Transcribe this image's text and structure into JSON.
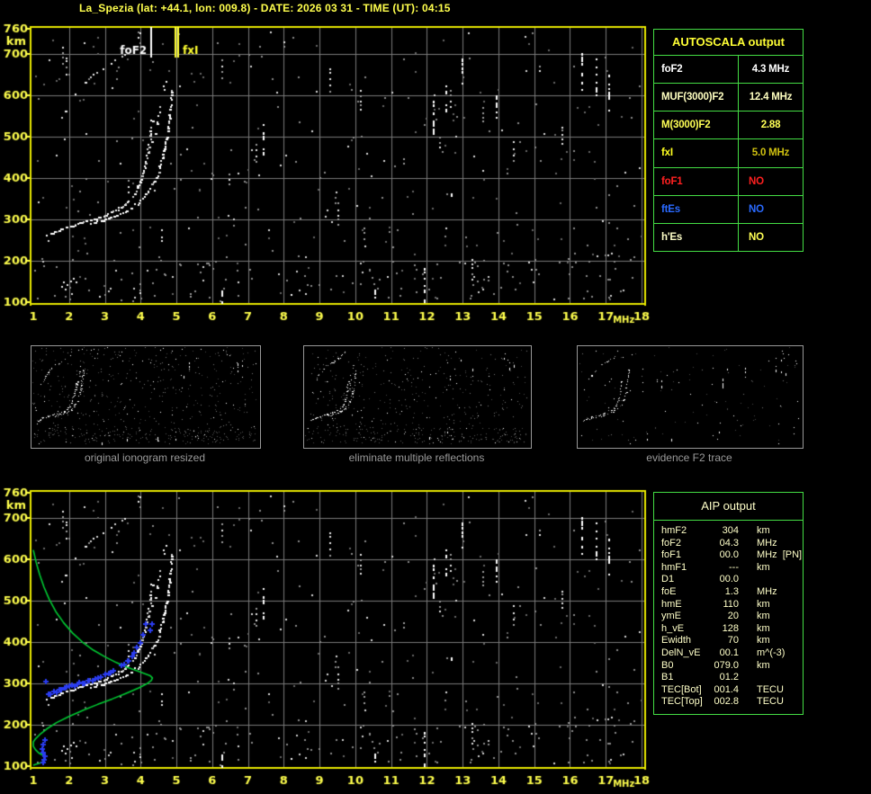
{
  "header": {
    "title": "La_Spezia (lat: +44.1, lon: 009.8) - DATE: 2026 03 31 - TIME (UT): 04:15"
  },
  "colors": {
    "background": "#000000",
    "title_yellow": "#ffff4d",
    "axis_yellow": "#ffff4d",
    "plot_border_yellow": "#e8e800",
    "grid_gray": "#7a7a7a",
    "trace_white": "#ffffff",
    "noise_gray": "#8a8a8a",
    "table_border_green": "#44dd44",
    "profile_green": "#00cc33",
    "scaled_blue": "#2a3cf0",
    "caption_gray": "#9a9a9a",
    "status_red": "#ff2020",
    "status_blue": "#2a6aff",
    "pale_yellow": "#ffffc8",
    "gold": "#cfc010",
    "marker_fof2": "#ffffff",
    "marker_fxi": "#ffff30"
  },
  "autoscala_table": {
    "title": "AUTOSCALA output",
    "rows": [
      {
        "label": "foF2",
        "value": "4.3 MHz",
        "color": "#ffffff",
        "value_color": "#ffffff"
      },
      {
        "label": "MUF(3000)F2",
        "value": "12.4 MHz",
        "color": "#ffffc0",
        "value_color": "#ffffc0"
      },
      {
        "label": "M(3000)F2",
        "value": "2.88",
        "color": "#ffff55",
        "value_color": "#ffff55"
      },
      {
        "label": "fxI",
        "value": "5.0 MHz",
        "color": "#ffff20",
        "value_color": "#cfc010"
      },
      {
        "label": "foF1",
        "value": "NO",
        "color": "#ff2020",
        "value_color": "#ff2020"
      },
      {
        "label": "ftEs",
        "value": "NO",
        "color": "#2a6aff",
        "value_color": "#2a6aff"
      },
      {
        "label": "h'Es",
        "value": "NO",
        "color": "#ffffc8",
        "value_color": "#ffff55"
      }
    ]
  },
  "aip_table": {
    "title": "AIP output",
    "rows": [
      {
        "label": "hmF2",
        "value": "304",
        "unit": "km"
      },
      {
        "label": "foF2",
        "value": "04.3",
        "unit": "MHz"
      },
      {
        "label": "foF1",
        "value": "00.0",
        "unit": "MHz  [PN]"
      },
      {
        "label": "hmF1",
        "value": "---",
        "unit": "km"
      },
      {
        "label": "D1",
        "value": "00.0",
        "unit": ""
      },
      {
        "label": "foE",
        "value": "1.3",
        "unit": "MHz"
      },
      {
        "label": "hmE",
        "value": "110",
        "unit": "km"
      },
      {
        "label": "ymE",
        "value": "20",
        "unit": "km"
      },
      {
        "label": "h_vE",
        "value": "128",
        "unit": "km"
      },
      {
        "label": "Ewidth",
        "value": "70",
        "unit": "km"
      },
      {
        "label": "DelN_vE",
        "value": "00.1",
        "unit": "m^(-3)"
      },
      {
        "label": "B0",
        "value": "079.0",
        "unit": "km"
      },
      {
        "label": "B1",
        "value": "01.2",
        "unit": ""
      },
      {
        "label": "TEC[Bot]",
        "value": "001.4",
        "unit": "TECU"
      },
      {
        "label": "TEC[Top]",
        "value": "002.8",
        "unit": "TECU"
      }
    ]
  },
  "thumbnails": [
    {
      "caption": "original ionogram resized"
    },
    {
      "caption": "eliminate multiple reflections"
    },
    {
      "caption": "evidence F2 trace"
    }
  ],
  "chart_data": {
    "type": "scatter",
    "title": "vertical-incidence ionogram, virtual height vs frequency",
    "xlabel": "MHz",
    "ylabel": "km",
    "xlim": [
      1,
      18
    ],
    "ylim": [
      100,
      760
    ],
    "x_ticks": [
      1,
      2,
      3,
      4,
      5,
      6,
      7,
      8,
      9,
      10,
      11,
      12,
      13,
      14,
      15,
      16,
      17,
      18
    ],
    "y_ticks": [
      760,
      700,
      600,
      500,
      400,
      300,
      200,
      100
    ],
    "grid": true,
    "markers": {
      "foF2_label": "foF2",
      "foF2_MHz": 4.3,
      "fxI_label": "fxI",
      "fxI_MHz": 5.0
    },
    "noise_seed": 7,
    "o_trace": [
      [
        1.38,
        262
      ],
      [
        1.6,
        271
      ],
      [
        1.85,
        279
      ],
      [
        2.1,
        286
      ],
      [
        2.4,
        293
      ],
      [
        2.7,
        301
      ],
      [
        3.0,
        310
      ],
      [
        3.25,
        320
      ],
      [
        3.5,
        333
      ],
      [
        3.7,
        348
      ],
      [
        3.85,
        366
      ],
      [
        3.98,
        389
      ],
      [
        4.08,
        414
      ],
      [
        4.16,
        444
      ],
      [
        4.23,
        480
      ],
      [
        4.28,
        515
      ],
      [
        4.32,
        545
      ]
    ],
    "x_trace": [
      [
        2.6,
        290
      ],
      [
        2.95,
        299
      ],
      [
        3.25,
        308
      ],
      [
        3.55,
        318
      ],
      [
        3.8,
        331
      ],
      [
        4.0,
        346
      ],
      [
        4.2,
        365
      ],
      [
        4.37,
        389
      ],
      [
        4.5,
        416
      ],
      [
        4.6,
        447
      ],
      [
        4.69,
        482
      ],
      [
        4.76,
        520
      ],
      [
        4.82,
        560
      ],
      [
        4.86,
        600
      ],
      [
        4.88,
        625
      ]
    ],
    "hop2_o": [
      [
        1.8,
        548
      ],
      [
        2.0,
        578
      ],
      [
        2.2,
        602
      ],
      [
        2.5,
        638
      ],
      [
        2.85,
        660
      ],
      [
        3.2,
        678
      ],
      [
        3.55,
        697
      ],
      [
        3.8,
        716
      ],
      [
        3.95,
        738
      ],
      [
        4.03,
        757
      ]
    ],
    "hop2_x": [
      [
        4.28,
        478
      ],
      [
        4.38,
        508
      ],
      [
        4.48,
        545
      ],
      [
        4.58,
        582
      ],
      [
        4.66,
        620
      ],
      [
        4.72,
        655
      ]
    ],
    "e_cluster": [
      [
        1.78,
        138
      ],
      [
        1.85,
        148
      ],
      [
        1.95,
        143
      ],
      [
        2.05,
        150
      ],
      [
        2.12,
        158
      ],
      [
        1.9,
        132
      ],
      [
        2.2,
        148
      ]
    ],
    "streaks": [
      [
        6.28,
        100,
        128
      ],
      [
        8.22,
        100,
        130
      ],
      [
        10.55,
        100,
        142
      ],
      [
        11.95,
        106,
        182
      ],
      [
        7.45,
        460,
        540
      ],
      [
        12.2,
        500,
        585
      ],
      [
        12.55,
        545,
        622
      ],
      [
        13.0,
        618,
        688
      ],
      [
        13.95,
        545,
        622
      ],
      [
        16.35,
        608,
        700
      ],
      [
        16.75,
        596,
        688
      ],
      [
        17.1,
        554,
        648
      ],
      [
        12.7,
        350,
        362
      ]
    ],
    "profile_green": [
      [
        1.0,
        622
      ],
      [
        1.08,
        592
      ],
      [
        1.18,
        562
      ],
      [
        1.3,
        532
      ],
      [
        1.45,
        502
      ],
      [
        1.63,
        473
      ],
      [
        1.85,
        446
      ],
      [
        2.1,
        421
      ],
      [
        2.38,
        399
      ],
      [
        2.68,
        380
      ],
      [
        3.0,
        364
      ],
      [
        3.32,
        350
      ],
      [
        3.62,
        339
      ],
      [
        3.9,
        330
      ],
      [
        4.12,
        323
      ],
      [
        4.27,
        318
      ],
      [
        4.33,
        313
      ],
      [
        4.3,
        307
      ],
      [
        4.18,
        299
      ],
      [
        3.95,
        289
      ],
      [
        3.6,
        276
      ],
      [
        3.2,
        262
      ],
      [
        2.8,
        249
      ],
      [
        2.4,
        235
      ],
      [
        2.0,
        220
      ],
      [
        1.65,
        205
      ],
      [
        1.38,
        190
      ],
      [
        1.18,
        176
      ],
      [
        1.05,
        165
      ],
      [
        1.0,
        158
      ],
      [
        1.0,
        148
      ],
      [
        1.06,
        140
      ],
      [
        1.15,
        132
      ],
      [
        1.27,
        126
      ],
      [
        1.33,
        119
      ],
      [
        1.3,
        112
      ],
      [
        1.18,
        107
      ],
      [
        1.05,
        104
      ],
      [
        1.0,
        102
      ]
    ],
    "blue_trace_range": [
      1.44,
      4.2
    ],
    "blue_top_points": [
      [
        4.28,
        426
      ],
      [
        4.33,
        441
      ]
    ],
    "blue_e_points": [
      [
        1.28,
        107
      ],
      [
        1.31,
        115
      ],
      [
        1.34,
        123
      ],
      [
        1.3,
        132
      ],
      [
        1.27,
        141
      ],
      [
        1.3,
        151
      ],
      [
        1.33,
        161
      ],
      [
        1.37,
        304
      ]
    ]
  }
}
